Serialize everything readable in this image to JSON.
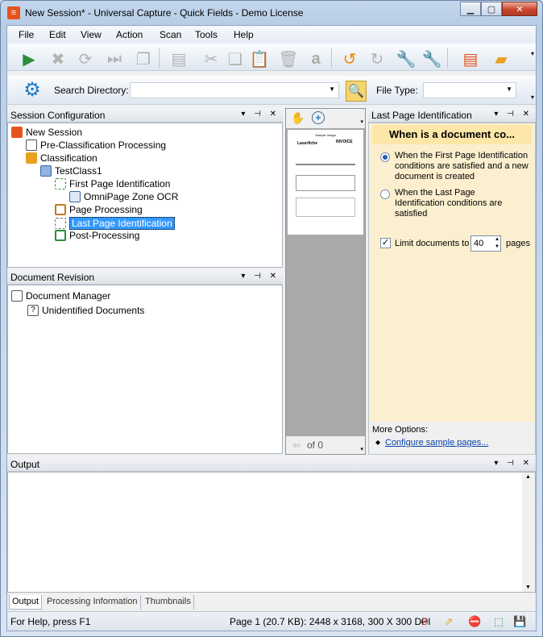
{
  "window": {
    "title": "New Session* - Universal Capture - Quick Fields - Demo License"
  },
  "menu": [
    "File",
    "Edit",
    "View",
    "Action",
    "Scan",
    "Tools",
    "Help"
  ],
  "search": {
    "label": "Search Directory:",
    "value": "",
    "filetype_label": "File Type:",
    "filetype_value": ""
  },
  "session_config": {
    "title": "Session Configuration",
    "items": [
      "New Session",
      "Pre-Classification Processing",
      "Classification",
      "TestClass1",
      "First Page Identification",
      "OmniPage Zone OCR",
      "Page Processing",
      "Last Page Identification",
      "Post-Processing"
    ]
  },
  "doc_revision": {
    "title": "Document Revision",
    "items": [
      "Document Manager",
      "Unidentified Documents"
    ]
  },
  "preview": {
    "page_label": "of 0",
    "sample_title": "Sample Image",
    "invoice_label": "INVOICE",
    "brand": "Laserfiche"
  },
  "last_page": {
    "title": "Last Page Identification",
    "heading": "When is a document co...",
    "option1": "When the First Page Identification conditions are satisfied and a new document is created",
    "option2": "When the Last Page Identification conditions are satisfied",
    "limit_label": "Limit documents to",
    "limit_value": "40",
    "limit_suffix": "pages",
    "more_options": "More Options:",
    "configure_link": "Configure sample pages..."
  },
  "output": {
    "title": "Output",
    "tabs": [
      "Output",
      "Processing Information",
      "Thumbnails"
    ]
  },
  "status": {
    "help": "For Help, press F1",
    "page_info": "Page 1 (20.7 KB): 2448 x 3168, 300 X 300 DPI"
  },
  "colors": {
    "accent": "#3399ff",
    "panel_yellow": "#fcefcf"
  }
}
